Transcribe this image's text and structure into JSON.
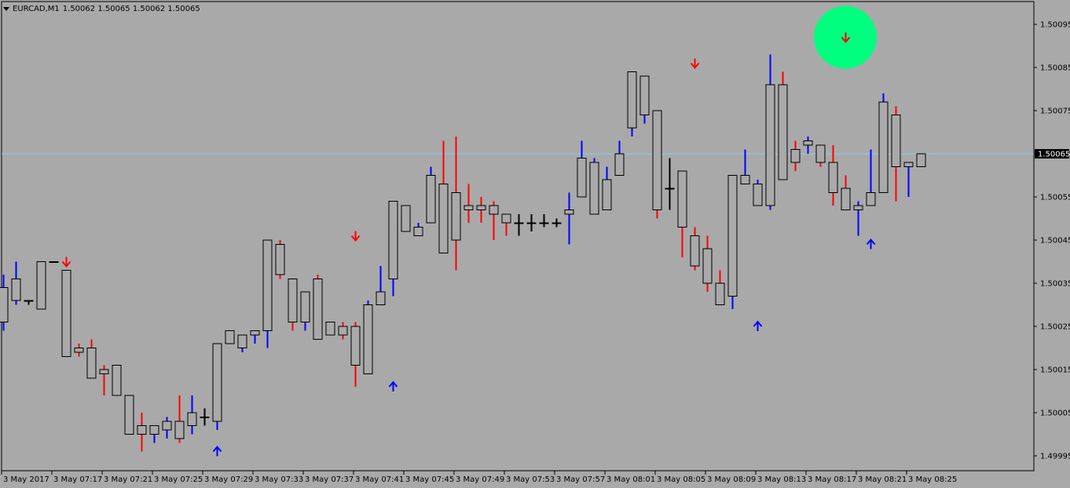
{
  "header": {
    "symbol": "EURCAD,M1",
    "ohlc": "1.50062 1.50065 1.50062 1.50065"
  },
  "current_price_label": "1.50065",
  "colors": {
    "background": "#a9a9a9",
    "bull": "#0000ff",
    "bear": "#ff0000",
    "neutral": "#000000",
    "bid_line": "#87ceeb",
    "price_tag_bg": "#000000",
    "price_tag_fg": "#ffffff",
    "signal_up": "#0000ff",
    "signal_down": "#ff0000",
    "highlight": "#00ff7f"
  },
  "chart_data": {
    "type": "candlestick",
    "symbol": "EURCAD",
    "timeframe": "M1",
    "ylim": [
      1.49988,
      1.501
    ],
    "y_ticks": [
      "1.50095",
      "1.50085",
      "1.50075",
      "1.50065",
      "1.50055",
      "1.50045",
      "1.50035",
      "1.50025",
      "1.50015",
      "1.50005",
      "1.49995"
    ],
    "x_ticks": [
      {
        "bar": 0,
        "label": "3 May 2017"
      },
      {
        "bar": 4,
        "label": "3 May 07:17"
      },
      {
        "bar": 8,
        "label": "3 May 07:21"
      },
      {
        "bar": 12,
        "label": "3 May 07:25"
      },
      {
        "bar": 16,
        "label": "3 May 07:29"
      },
      {
        "bar": 20,
        "label": "3 May 07:33"
      },
      {
        "bar": 24,
        "label": "3 May 07:37"
      },
      {
        "bar": 28,
        "label": "3 May 07:41"
      },
      {
        "bar": 32,
        "label": "3 May 07:45"
      },
      {
        "bar": 36,
        "label": "3 May 07:49"
      },
      {
        "bar": 40,
        "label": "3 May 07:53"
      },
      {
        "bar": 44,
        "label": "3 May 07:57"
      },
      {
        "bar": 48,
        "label": "3 May 08:01"
      },
      {
        "bar": 52,
        "label": "3 May 08:05"
      },
      {
        "bar": 56,
        "label": "3 May 08:09"
      },
      {
        "bar": 60,
        "label": "3 May 08:13"
      },
      {
        "bar": 64,
        "label": "3 May 08:17"
      },
      {
        "bar": 68,
        "label": "3 May 08:21"
      },
      {
        "bar": 72,
        "label": "3 May 08:25"
      }
    ],
    "bid": 1.50065,
    "candles": [
      {
        "o": 1.50026,
        "h": 1.50037,
        "l": 1.50024,
        "c": 1.50034
      },
      {
        "o": 1.50031,
        "h": 1.5004,
        "l": 1.5003,
        "c": 1.50036
      },
      {
        "o": 1.50031,
        "h": 1.50031,
        "l": 1.5003,
        "c": 1.50031
      },
      {
        "o": 1.50029,
        "h": 1.5004,
        "l": 1.50029,
        "c": 1.5004
      },
      {
        "o": 1.5004,
        "h": 1.5004,
        "l": 1.5004,
        "c": 1.5004
      },
      {
        "o": 1.50038,
        "h": 1.50038,
        "l": 1.50018,
        "c": 1.50018
      },
      {
        "o": 1.5002,
        "h": 1.50021,
        "l": 1.50018,
        "c": 1.50019
      },
      {
        "o": 1.5002,
        "h": 1.50022,
        "l": 1.50013,
        "c": 1.50013
      },
      {
        "o": 1.50015,
        "h": 1.50016,
        "l": 1.50009,
        "c": 1.50014
      },
      {
        "o": 1.50016,
        "h": 1.50016,
        "l": 1.50009,
        "c": 1.50009
      },
      {
        "o": 1.50009,
        "h": 1.50009,
        "l": 1.5,
        "c": 1.5
      },
      {
        "o": 1.50002,
        "h": 1.50005,
        "l": 1.49996,
        "c": 1.5
      },
      {
        "o": 1.5,
        "h": 1.50002,
        "l": 1.49998,
        "c": 1.50002
      },
      {
        "o": 1.50001,
        "h": 1.50004,
        "l": 1.49999,
        "c": 1.50003
      },
      {
        "o": 1.50003,
        "h": 1.50009,
        "l": 1.49998,
        "c": 1.49999
      },
      {
        "o": 1.50002,
        "h": 1.50009,
        "l": 1.5,
        "c": 1.50005
      },
      {
        "o": 1.50004,
        "h": 1.50006,
        "l": 1.50002,
        "c": 1.50004
      },
      {
        "o": 1.50003,
        "h": 1.50021,
        "l": 1.50001,
        "c": 1.50021
      },
      {
        "o": 1.50021,
        "h": 1.50024,
        "l": 1.50021,
        "c": 1.50024
      },
      {
        "o": 1.5002,
        "h": 1.50023,
        "l": 1.50019,
        "c": 1.50023
      },
      {
        "o": 1.50023,
        "h": 1.50024,
        "l": 1.50021,
        "c": 1.50024
      },
      {
        "o": 1.50024,
        "h": 1.50045,
        "l": 1.5002,
        "c": 1.50045
      },
      {
        "o": 1.50044,
        "h": 1.50045,
        "l": 1.50036,
        "c": 1.50037
      },
      {
        "o": 1.50036,
        "h": 1.50036,
        "l": 1.50024,
        "c": 1.50026
      },
      {
        "o": 1.50026,
        "h": 1.50033,
        "l": 1.50024,
        "c": 1.50033
      },
      {
        "o": 1.50036,
        "h": 1.50037,
        "l": 1.50022,
        "c": 1.50022
      },
      {
        "o": 1.50023,
        "h": 1.50026,
        "l": 1.50023,
        "c": 1.50026
      },
      {
        "o": 1.50025,
        "h": 1.50026,
        "l": 1.50022,
        "c": 1.50023
      },
      {
        "o": 1.50025,
        "h": 1.50026,
        "l": 1.50011,
        "c": 1.50016
      },
      {
        "o": 1.50014,
        "h": 1.50031,
        "l": 1.50014,
        "c": 1.5003
      },
      {
        "o": 1.5003,
        "h": 1.50039,
        "l": 1.5003,
        "c": 1.50033
      },
      {
        "o": 1.50036,
        "h": 1.50054,
        "l": 1.50032,
        "c": 1.50054
      },
      {
        "o": 1.50047,
        "h": 1.50053,
        "l": 1.50047,
        "c": 1.50053
      },
      {
        "o": 1.50046,
        "h": 1.50049,
        "l": 1.50046,
        "c": 1.50048
      },
      {
        "o": 1.50049,
        "h": 1.50062,
        "l": 1.50049,
        "c": 1.5006
      },
      {
        "o": 1.50058,
        "h": 1.50068,
        "l": 1.50042,
        "c": 1.50042
      },
      {
        "o": 1.50056,
        "h": 1.50069,
        "l": 1.50038,
        "c": 1.50045
      },
      {
        "o": 1.50053,
        "h": 1.50058,
        "l": 1.50049,
        "c": 1.50052
      },
      {
        "o": 1.50053,
        "h": 1.50055,
        "l": 1.50049,
        "c": 1.50052
      },
      {
        "o": 1.50053,
        "h": 1.50054,
        "l": 1.50045,
        "c": 1.50051
      },
      {
        "o": 1.50051,
        "h": 1.50051,
        "l": 1.50046,
        "c": 1.50049
      },
      {
        "o": 1.50049,
        "h": 1.50051,
        "l": 1.50046,
        "c": 1.50049
      },
      {
        "o": 1.50049,
        "h": 1.50051,
        "l": 1.50047,
        "c": 1.50049
      },
      {
        "o": 1.50049,
        "h": 1.50051,
        "l": 1.50048,
        "c": 1.50049
      },
      {
        "o": 1.50049,
        "h": 1.5005,
        "l": 1.50048,
        "c": 1.50049
      },
      {
        "o": 1.50051,
        "h": 1.50056,
        "l": 1.50044,
        "c": 1.50052
      },
      {
        "o": 1.50055,
        "h": 1.50068,
        "l": 1.50055,
        "c": 1.50064
      },
      {
        "o": 1.50051,
        "h": 1.50064,
        "l": 1.50051,
        "c": 1.50063
      },
      {
        "o": 1.50052,
        "h": 1.50062,
        "l": 1.50052,
        "c": 1.50059
      },
      {
        "o": 1.5006,
        "h": 1.50068,
        "l": 1.5006,
        "c": 1.50065
      },
      {
        "o": 1.50071,
        "h": 1.50084,
        "l": 1.50069,
        "c": 1.50084
      },
      {
        "o": 1.50074,
        "h": 1.50083,
        "l": 1.50072,
        "c": 1.50083
      },
      {
        "o": 1.50075,
        "h": 1.50075,
        "l": 1.5005,
        "c": 1.50052
      },
      {
        "o": 1.50057,
        "h": 1.50064,
        "l": 1.50052,
        "c": 1.50057
      },
      {
        "o": 1.50061,
        "h": 1.50061,
        "l": 1.50041,
        "c": 1.50048
      },
      {
        "o": 1.50046,
        "h": 1.50048,
        "l": 1.50038,
        "c": 1.50039
      },
      {
        "o": 1.50043,
        "h": 1.50046,
        "l": 1.50033,
        "c": 1.50035
      },
      {
        "o": 1.50035,
        "h": 1.50038,
        "l": 1.50031,
        "c": 1.5003
      },
      {
        "o": 1.50032,
        "h": 1.5006,
        "l": 1.50029,
        "c": 1.5006
      },
      {
        "o": 1.50058,
        "h": 1.50066,
        "l": 1.50058,
        "c": 1.5006
      },
      {
        "o": 1.50053,
        "h": 1.50059,
        "l": 1.50053,
        "c": 1.50058
      },
      {
        "o": 1.50053,
        "h": 1.50088,
        "l": 1.50052,
        "c": 1.50081
      },
      {
        "o": 1.50081,
        "h": 1.50084,
        "l": 1.50059,
        "c": 1.50059
      },
      {
        "o": 1.50066,
        "h": 1.50068,
        "l": 1.50061,
        "c": 1.50063
      },
      {
        "o": 1.50067,
        "h": 1.50069,
        "l": 1.50065,
        "c": 1.50068
      },
      {
        "o": 1.50067,
        "h": 1.50067,
        "l": 1.50062,
        "c": 1.50063
      },
      {
        "o": 1.50063,
        "h": 1.50067,
        "l": 1.50053,
        "c": 1.50056
      },
      {
        "o": 1.50057,
        "h": 1.5006,
        "l": 1.50052,
        "c": 1.50052
      },
      {
        "o": 1.50052,
        "h": 1.50054,
        "l": 1.50046,
        "c": 1.50053
      },
      {
        "o": 1.50053,
        "h": 1.50066,
        "l": 1.50053,
        "c": 1.50056
      },
      {
        "o": 1.50056,
        "h": 1.50079,
        "l": 1.50056,
        "c": 1.50077
      },
      {
        "o": 1.50074,
        "h": 1.50076,
        "l": 1.50054,
        "c": 1.50062
      },
      {
        "o": 1.50062,
        "h": 1.50063,
        "l": 1.50055,
        "c": 1.50063
      },
      {
        "o": 1.50062,
        "h": 1.50065,
        "l": 1.50062,
        "c": 1.50065
      }
    ],
    "signals": [
      {
        "bar": 5,
        "price": 1.5004,
        "dir": "down"
      },
      {
        "bar": 17,
        "price": 1.49996,
        "dir": "up"
      },
      {
        "bar": 28,
        "price": 1.50046,
        "dir": "down"
      },
      {
        "bar": 31,
        "price": 1.50011,
        "dir": "up"
      },
      {
        "bar": 55,
        "price": 1.50086,
        "dir": "down"
      },
      {
        "bar": 60,
        "price": 1.50025,
        "dir": "up"
      },
      {
        "bar": 67,
        "price": 1.50092,
        "dir": "down"
      },
      {
        "bar": 69,
        "price": 1.50044,
        "dir": "up"
      }
    ],
    "highlight": {
      "bar": 67,
      "price": 1.50092
    }
  }
}
